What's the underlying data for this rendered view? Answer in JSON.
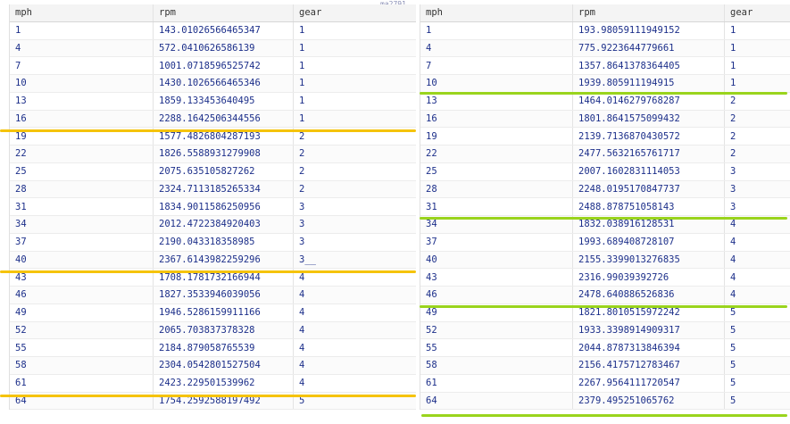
{
  "stray_text": "ma2791",
  "left_table": {
    "columns": [
      "mph",
      "rpm",
      "gear"
    ],
    "rows": [
      [
        "1",
        "143.01026566465347",
        "1"
      ],
      [
        "4",
        "572.0410626586139",
        "1"
      ],
      [
        "7",
        "1001.0718596525742",
        "1"
      ],
      [
        "10",
        "1430.1026566465346",
        "1"
      ],
      [
        "13",
        "1859.133453640495",
        "1"
      ],
      [
        "16",
        "2288.1642506344556",
        "1"
      ],
      [
        "19",
        "1577.4826804287193",
        "2"
      ],
      [
        "22",
        "1826.5588931279908",
        "2"
      ],
      [
        "25",
        "2075.635105827262",
        "2"
      ],
      [
        "28",
        "2324.7113185265334",
        "2"
      ],
      [
        "31",
        "1834.9011586250956",
        "3"
      ],
      [
        "34",
        "2012.4722384920403",
        "3"
      ],
      [
        "37",
        "2190.043318358985",
        "3"
      ],
      [
        "40",
        "2367.6143982259296",
        "3__"
      ],
      [
        "43",
        "1708.1781732166944",
        "4"
      ],
      [
        "46",
        "1827.3533946039056",
        "4"
      ],
      [
        "49",
        "1946.5286159911166",
        "4"
      ],
      [
        "52",
        "2065.703837378328",
        "4"
      ],
      [
        "55",
        "2184.879058765539",
        "4"
      ],
      [
        "58",
        "2304.0542801527504",
        "4"
      ],
      [
        "61",
        "2423.229501539962",
        "4"
      ],
      [
        "64",
        "1754.2592588197492",
        "5"
      ]
    ]
  },
  "right_table": {
    "columns": [
      "mph",
      "rpm",
      "gear"
    ],
    "rows": [
      [
        "1",
        "193.98059111949152",
        "1"
      ],
      [
        "4",
        "775.9223644779661",
        "1"
      ],
      [
        "7",
        "1357.8641378364405",
        "1"
      ],
      [
        "10",
        "1939.805911194915",
        "1"
      ],
      [
        "13",
        "1464.0146279768287",
        "2"
      ],
      [
        "16",
        "1801.8641575099432",
        "2"
      ],
      [
        "19",
        "2139.7136870430572",
        "2"
      ],
      [
        "22",
        "2477.5632165761717",
        "2"
      ],
      [
        "25",
        "2007.1602831114053",
        "3"
      ],
      [
        "28",
        "2248.0195170847737",
        "3"
      ],
      [
        "31",
        "2488.878751058143",
        "3"
      ],
      [
        "34",
        "1832.038916128531",
        "4"
      ],
      [
        "37",
        "1993.689408728107",
        "4"
      ],
      [
        "40",
        "2155.3399013276835",
        "4"
      ],
      [
        "43",
        "2316.99039392726",
        "4"
      ],
      [
        "46",
        "2478.640886526836",
        "4"
      ],
      [
        "49",
        "1821.8010515972242",
        "5"
      ],
      [
        "52",
        "1933.3398914909317",
        "5"
      ],
      [
        "55",
        "2044.8787313846394",
        "5"
      ],
      [
        "58",
        "2156.4175712783467",
        "5"
      ],
      [
        "61",
        "2267.9564111720547",
        "5"
      ],
      [
        "64",
        "2379.495251065762",
        "5"
      ]
    ]
  },
  "highlight_colors": {
    "left": "#f5c30b",
    "right": "#9ad41d"
  }
}
